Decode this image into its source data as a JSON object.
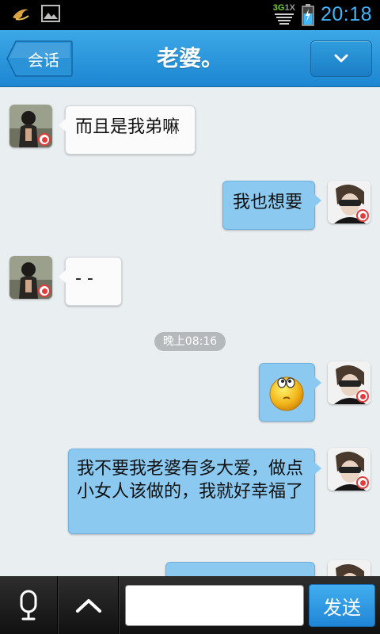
{
  "status": {
    "time": "20:18",
    "network": "3G",
    "network_sub": "1X"
  },
  "header": {
    "back_label": "会话",
    "title": "老婆。"
  },
  "messages": [
    {
      "side": "in",
      "text": "而且是我弟嘛"
    },
    {
      "side": "out",
      "text": "我也想要"
    },
    {
      "side": "in",
      "text": "- -"
    },
    {
      "side": "out",
      "text": "emoji",
      "emoji": "thinking-face"
    },
    {
      "side": "out",
      "text": "我不要我老婆有多大爱，做点小女人该做的，我就好幸福了"
    }
  ],
  "timestamp": "晚上08:16",
  "composer": {
    "placeholder": "",
    "send_label": "发送"
  },
  "colors": {
    "header": "#1c86d2",
    "out_bubble": "#8bc9f0",
    "in_bubble": "#fbfbfb",
    "time": "#3db7ff"
  }
}
